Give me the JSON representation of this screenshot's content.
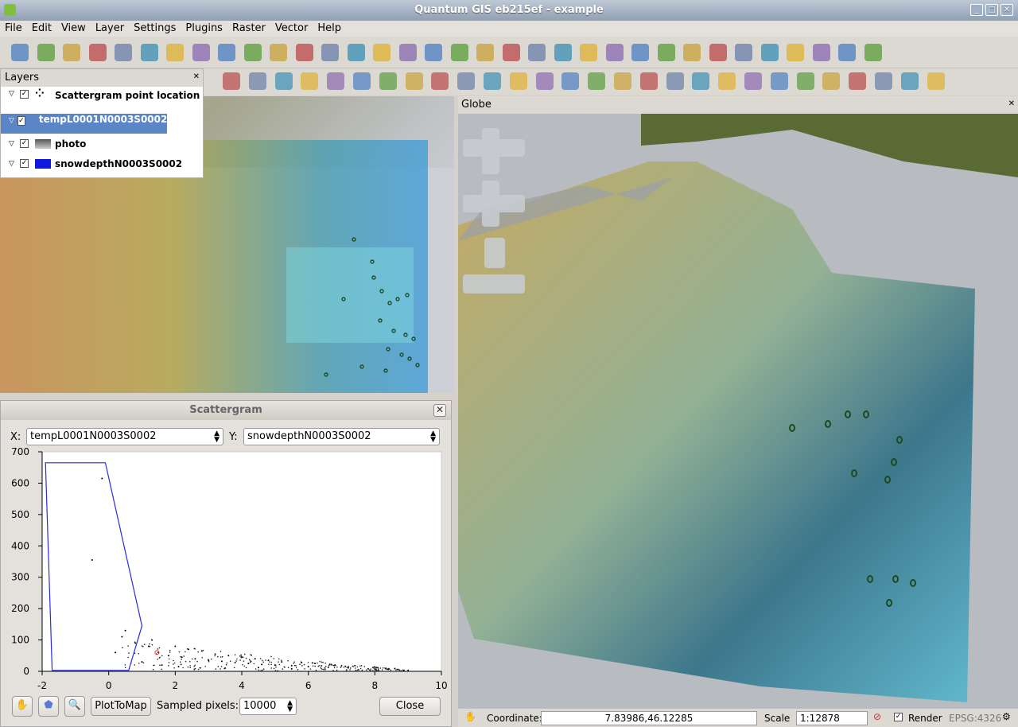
{
  "window": {
    "title": "Quantum GIS eb215ef - example",
    "btn_min": "_",
    "btn_max": "□",
    "btn_close": "✕"
  },
  "menu": [
    "File",
    "Edit",
    "View",
    "Layer",
    "Settings",
    "Plugins",
    "Raster",
    "Vector",
    "Help"
  ],
  "layers_panel": {
    "title": "Layers",
    "close": "✕",
    "layers": [
      {
        "name": "Scattergram point location",
        "checked": "✓"
      },
      {
        "name": "tempL0001N0003S0002",
        "checked": "✓",
        "selected": true
      },
      {
        "name": "photo",
        "checked": "✓"
      },
      {
        "name": "snowdepthN0003S0002",
        "checked": "✓"
      }
    ]
  },
  "scattergram": {
    "title": "Scattergram",
    "close": "✕",
    "x_label": "X:",
    "x_value": "tempL0001N0003S0002",
    "y_label": "Y:",
    "y_value": "snowdepthN0003S0002",
    "plot_to_map": "PlotToMap",
    "sampled_label": "Sampled pixels:",
    "sampled_value": "10000",
    "close_button": "Close"
  },
  "chart_data": {
    "type": "scatter",
    "x_ticks": [
      "-2",
      "0",
      "2",
      "4",
      "6",
      "8",
      "10"
    ],
    "y_ticks": [
      "0",
      "100",
      "200",
      "300",
      "400",
      "500",
      "600",
      "700"
    ],
    "xlim": [
      -2,
      10
    ],
    "ylim": [
      0,
      700
    ],
    "polygon": [
      [
        -1.9,
        665
      ],
      [
        -0.1,
        665
      ],
      [
        1,
        145
      ],
      [
        0.6,
        3
      ],
      [
        -1.7,
        3
      ]
    ],
    "points": [
      [
        -0.5,
        355
      ],
      [
        -0.2,
        615
      ],
      [
        0.4,
        110
      ],
      [
        0.8,
        90
      ],
      [
        1.2,
        80
      ],
      [
        1.5,
        60
      ],
      [
        1.8,
        50
      ],
      [
        2.2,
        45
      ],
      [
        2.6,
        40
      ],
      [
        3.0,
        35
      ],
      [
        3.4,
        32
      ],
      [
        3.8,
        28
      ],
      [
        4.2,
        25
      ],
      [
        4.6,
        22
      ],
      [
        5.0,
        20
      ],
      [
        5.5,
        18
      ],
      [
        6.0,
        15
      ],
      [
        6.6,
        13
      ],
      [
        7.2,
        11
      ],
      [
        7.8,
        8
      ],
      [
        8.4,
        6
      ],
      [
        9.0,
        3
      ],
      [
        0.2,
        60
      ],
      [
        0.5,
        130
      ],
      [
        1.0,
        30
      ],
      [
        1.3,
        100
      ],
      [
        2.0,
        80
      ],
      [
        2.4,
        70
      ],
      [
        2.8,
        65
      ],
      [
        3.2,
        55
      ],
      [
        3.6,
        50
      ],
      [
        4.0,
        45
      ],
      [
        4.4,
        40
      ],
      [
        4.8,
        35
      ],
      [
        5.2,
        30
      ],
      [
        5.8,
        28
      ],
      [
        6.2,
        25
      ],
      [
        6.8,
        20
      ],
      [
        7.4,
        18
      ],
      [
        8.0,
        14
      ],
      [
        8.6,
        9
      ],
      [
        1.6,
        20
      ],
      [
        2.1,
        15
      ],
      [
        3.5,
        10
      ],
      [
        4.5,
        12
      ],
      [
        5.5,
        8
      ],
      [
        6.5,
        6
      ]
    ],
    "highlight": [
      1.45,
      60
    ]
  },
  "globe": {
    "title": "Globe",
    "close": "✕"
  },
  "status": {
    "coord_label": "Coordinate:",
    "coord_value": "7.83986,46.12285",
    "scale_label": "Scale",
    "scale_value": "1:12878",
    "render_label": "Render",
    "render_checked": "✓",
    "crs": "EPSG:4326"
  }
}
